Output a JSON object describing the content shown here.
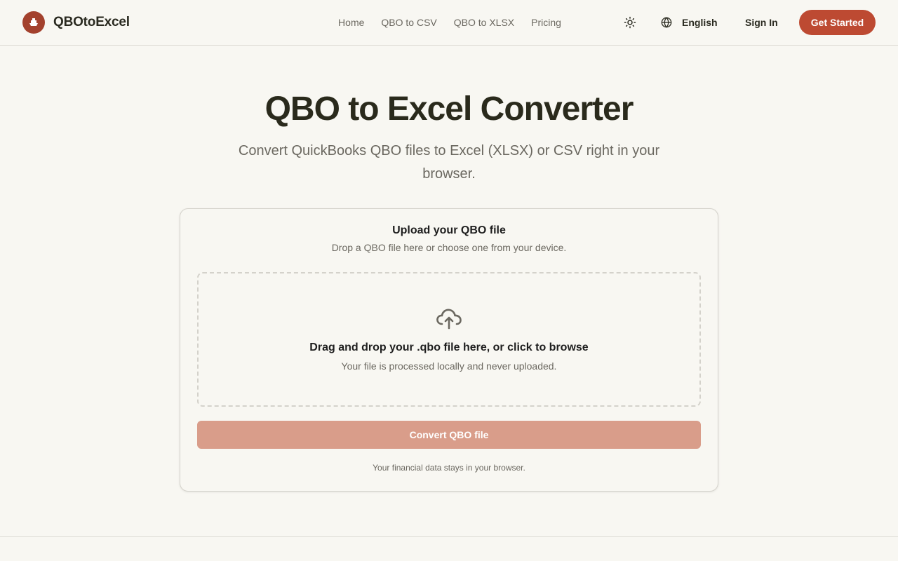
{
  "brand": {
    "name": "QBOtoExcel",
    "logo_icon": "ship-icon",
    "accent": "#bd4a32"
  },
  "nav": {
    "items": [
      {
        "label": "Home"
      },
      {
        "label": "QBO to CSV"
      },
      {
        "label": "QBO to XLSX"
      },
      {
        "label": "Pricing"
      }
    ]
  },
  "header": {
    "theme_icon": "sun-icon",
    "language_icon": "globe-icon",
    "language_label": "English",
    "sign_in_label": "Sign In",
    "get_started_label": "Get Started"
  },
  "hero": {
    "title": "QBO to Excel Converter",
    "subtitle": "Convert QuickBooks QBO files to Excel (XLSX) or CSV right in your browser."
  },
  "upload_card": {
    "title": "Upload your QBO file",
    "description": "Drop a QBO file here or choose one from your device.",
    "dropzone_icon": "cloud-upload-icon",
    "dropzone_title": "Drag and drop your .qbo file here, or click to browse",
    "dropzone_subtitle": "Your file is processed locally and never uploaded.",
    "convert_label": "Convert QBO file",
    "convert_color": "#d99d8a",
    "footnote": "Your financial data stays in your browser."
  }
}
